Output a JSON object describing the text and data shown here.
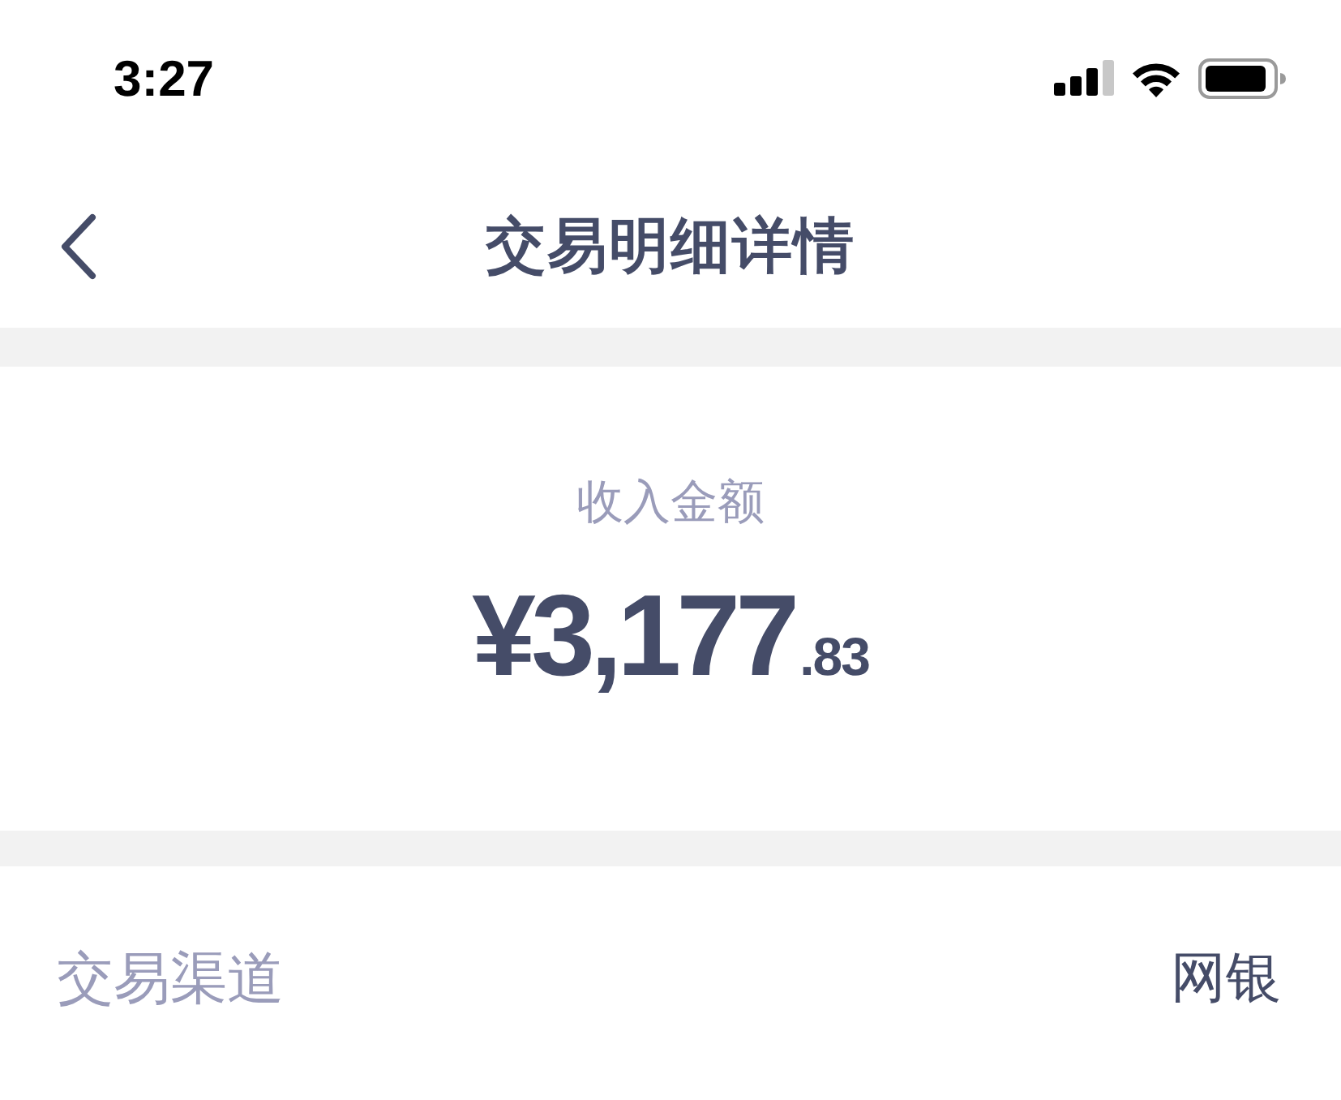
{
  "status_bar": {
    "time": "3:27"
  },
  "nav_bar": {
    "title": "交易明细详情"
  },
  "amount_card": {
    "label": "收入金额",
    "integer_part": "¥3,177",
    "fraction_part": ".83"
  },
  "details": [
    {
      "label": "交易渠道",
      "value": "网银"
    }
  ]
}
